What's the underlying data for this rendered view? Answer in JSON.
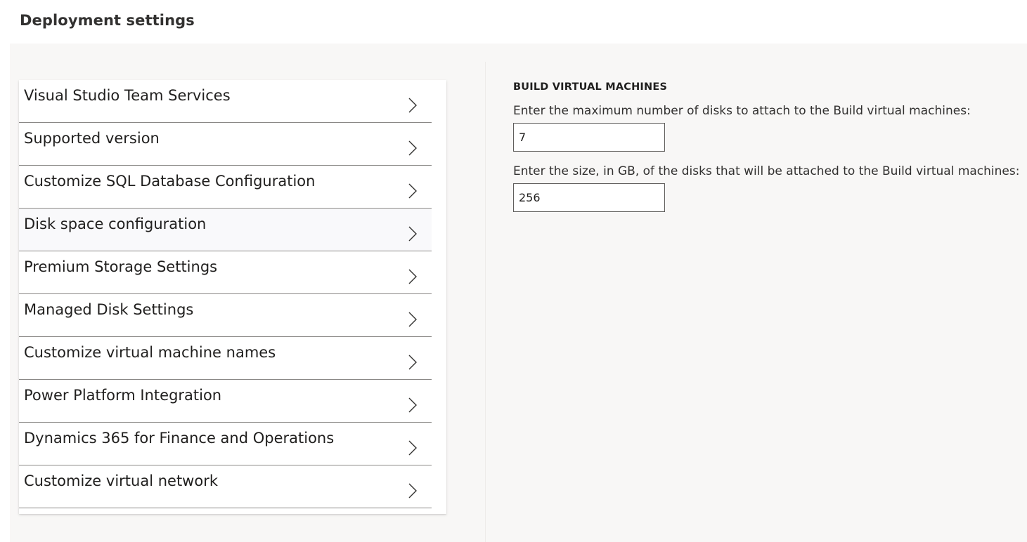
{
  "page": {
    "title": "Deployment settings"
  },
  "nav": {
    "selected_index": 3,
    "items": [
      {
        "label": "Visual Studio Team Services"
      },
      {
        "label": "Supported version"
      },
      {
        "label": "Customize SQL Database Configuration"
      },
      {
        "label": "Disk space configuration"
      },
      {
        "label": "Premium Storage Settings"
      },
      {
        "label": "Managed Disk Settings"
      },
      {
        "label": "Customize virtual machine names"
      },
      {
        "label": "Power Platform Integration"
      },
      {
        "label": "Dynamics 365 for Finance and Operations"
      },
      {
        "label": "Customize virtual network"
      }
    ]
  },
  "content": {
    "section_title": "BUILD VIRTUAL MACHINES",
    "max_disks_label": "Enter the maximum number of disks to attach to the Build virtual machines:",
    "max_disks_value": "7",
    "disk_size_label": "Enter the size, in GB, of the disks that will be attached to the Build virtual machines:",
    "disk_size_value": "256"
  }
}
